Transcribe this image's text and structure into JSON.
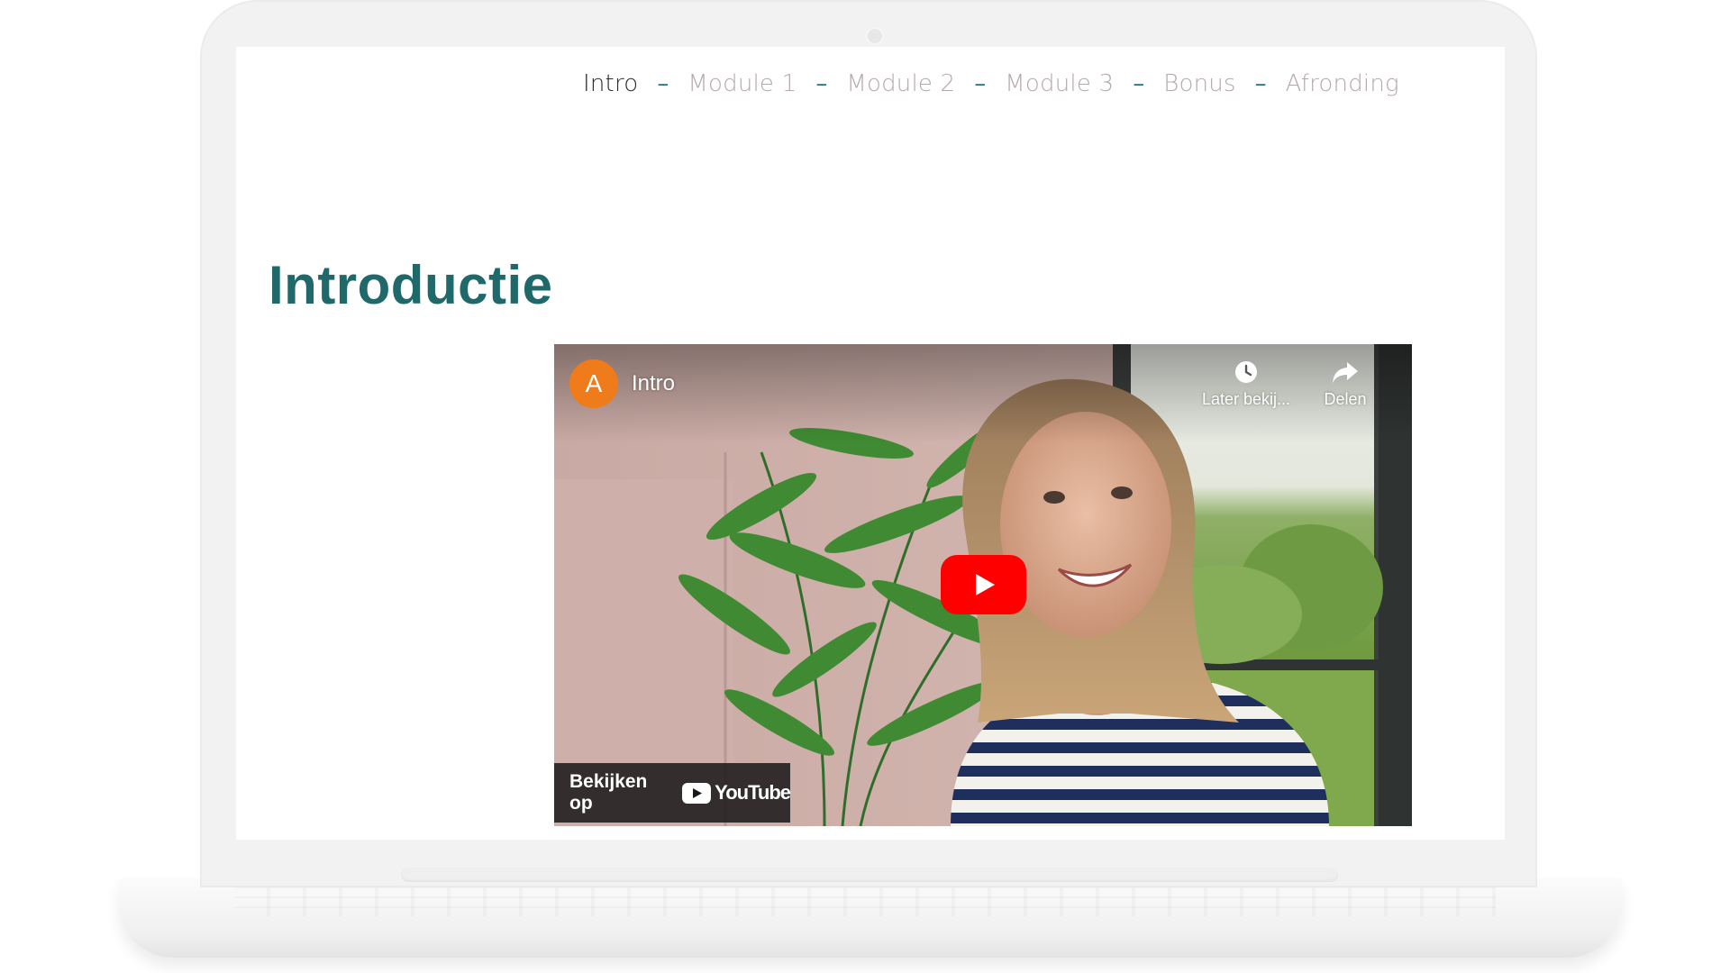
{
  "nav": {
    "items": [
      {
        "label": "Intro",
        "active": true
      },
      {
        "label": "Module 1",
        "active": false
      },
      {
        "label": "Module 2",
        "active": false
      },
      {
        "label": "Module 3",
        "active": false
      },
      {
        "label": "Bonus",
        "active": false
      },
      {
        "label": "Afronding",
        "active": false
      }
    ],
    "separator": "–"
  },
  "page": {
    "title": "Introductie"
  },
  "video": {
    "channel_initial": "A",
    "title": "Intro",
    "watch_later_label": "Later bekij...",
    "share_label": "Delen",
    "watch_on_label": "Bekijken op",
    "platform_name": "YouTube",
    "play_icon": "play-icon",
    "colors": {
      "play_button": "#ff0000",
      "avatar": "#f07b1b"
    }
  },
  "colors": {
    "title": "#20696a",
    "nav_active": "#2b2b2b",
    "nav_inactive": "#b5a9ad",
    "nav_separator": "#2a7a78"
  }
}
